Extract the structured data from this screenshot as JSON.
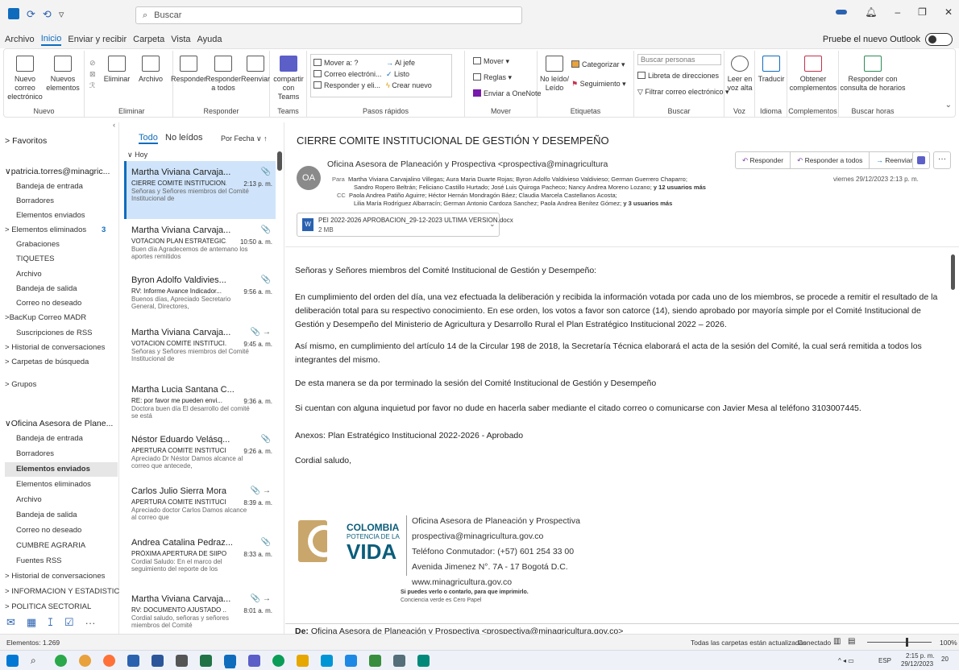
{
  "titlebar": {
    "search_placeholder": "Buscar",
    "undo": "⟲",
    "redo": "⟳",
    "customize": "▿"
  },
  "menu": [
    "Archivo",
    "Inicio",
    "Enviar y recibir",
    "Carpeta",
    "Vista",
    "Ayuda"
  ],
  "try_new": "Pruebe el nuevo Outlook",
  "ribbon": {
    "nuevo": {
      "nuevo_correo": "Nuevo correo electrónico",
      "nuevos": "Nuevos elementos",
      "label": "Nuevo"
    },
    "eliminar": {
      "eliminar": "Eliminar",
      "archivo": "Archivo",
      "label": "Eliminar"
    },
    "responder": {
      "responder": "Responder",
      "responder_todos": "Responder a todos",
      "reenviar": "Reenviar",
      "label": "Responder"
    },
    "teams": {
      "compartir": "compartir con Teams",
      "label": "Teams"
    },
    "pasos": {
      "items": [
        "Mover a: ?",
        "Correo electróni...",
        "Responder y eli...",
        "Al jefe",
        "Listo",
        "Crear nuevo"
      ],
      "label": "Pasos rápidos"
    },
    "mover": {
      "mover": "Mover",
      "reglas": "Reglas",
      "onenote": "Enviar a OneNote",
      "label": "Mover"
    },
    "etiquetas": {
      "noleido": "No leído/ Leído",
      "categorizar": "Categorizar",
      "seguimiento": "Seguimiento",
      "label": "Etiquetas"
    },
    "buscar": {
      "personas": "Buscar personas",
      "libreta": "Libreta de direcciones",
      "filtrar": "Filtrar correo electrónico",
      "label": "Buscar"
    },
    "voz": {
      "leer": "Leer en voz alta",
      "label": "Voz"
    },
    "idioma": {
      "traducir": "Traducir",
      "label": "Idioma"
    },
    "complementos": {
      "obtener": "Obtener complementos",
      "label": "Complementos"
    },
    "horas": {
      "responder": "Responder con consulta de horarios",
      "label": "Buscar horas"
    }
  },
  "nav": {
    "favoritos": "Favoritos",
    "account1": "patricia.torres@minagric...",
    "a1": [
      "Bandeja de entrada",
      "Borradores",
      "Elementos enviados",
      "Elementos eliminados",
      "Grabaciones",
      "TIQUETES",
      "Archivo",
      "Bandeja de salida",
      "Correo no deseado",
      "BacKup Correo MADR",
      "Suscripciones de RSS",
      "Historial de conversaciones",
      "Carpetas de búsqueda"
    ],
    "eliminados_count": "3",
    "grupos": "Grupos",
    "account2": "Oficina Asesora de Plane...",
    "a2": [
      "Bandeja de entrada",
      "Borradores",
      "Elementos enviados",
      "Elementos eliminados",
      "Archivo",
      "Bandeja de salida",
      "Correo no deseado",
      "CUMBRE AGRARIA",
      "Fuentes RSS",
      "Historial de conversaciones",
      "INFORMACION Y ESTADISTICA",
      "POLITICA SECTORIAL"
    ]
  },
  "list": {
    "todo": "Todo",
    "noleidos": "No leídos",
    "porfecha": "Por Fecha",
    "hoy": "Hoy",
    "messages": [
      {
        "sender": "Martha Viviana Carvaja...",
        "subject": "CIERRE COMITE INSTITUCION...",
        "preview": "Señoras y Señores miembros del Comité Institucional de",
        "time": "2:13 p. m.",
        "icon": "📎"
      },
      {
        "sender": "Martha Viviana Carvaja...",
        "subject": "VOTACION PLAN ESTRATEGIC...",
        "preview": "Buen día  Agradecemos de antemano los aportes remitidos",
        "time": "10:50 a. m.",
        "icon": "📎"
      },
      {
        "sender": "Byron Adolfo Valdivies...",
        "subject": "RV: Informe Avance Indicador...",
        "preview": "Buenos días, Apreciado Secretario General, Directores,",
        "time": "9:56 a. m.",
        "icon": "📎"
      },
      {
        "sender": "Martha Viviana Carvaja...",
        "subject": "VOTACION COMITE INSTITUCI...",
        "preview": "Señoras y Señores miembros del Comité Institucional de",
        "time": "9:45 a. m.",
        "icon": "📎 →"
      },
      {
        "sender": "Martha Lucia Santana C...",
        "subject": "RE: por favor me pueden envi...",
        "preview": "Doctora buen día El desarrollo del comité se está",
        "time": "9:36 a. m.",
        "icon": ""
      },
      {
        "sender": "Néstor Eduardo Velásq...",
        "subject": "APERTURA COMITE INSTITUCI...",
        "preview": "Apreciado Dr Néstor  Damos alcance al correo que antecede,",
        "time": "9:26 a. m.",
        "icon": "📎"
      },
      {
        "sender": "Carlos Julio Sierra Mora",
        "subject": "APERTURA COMITE INSTITUCI...",
        "preview": "Apreciado doctor Carlos Damos alcance al correo que",
        "time": "8:39 a. m.",
        "icon": "📎 →"
      },
      {
        "sender": "Andrea Catalina Pedraz...",
        "subject": "PRÓXIMA APERTURA DE SIIPO;...",
        "preview": "Cordial Saludo:  En el marco del seguimiento del reporte de los",
        "time": "8:33 a. m.",
        "icon": "📎"
      },
      {
        "sender": "Martha Viviana Carvaja...",
        "subject": "RV: DOCUMENTO AJUSTADO ...",
        "preview": "Cordial saludo, señoras y señores miembros del Comité",
        "time": "8:01 a. m.",
        "icon": "📎 →"
      }
    ]
  },
  "reader": {
    "subject": "CIERRE COMITE INSTITUCIONAL DE GESTIÓN Y DESEMPEÑO",
    "avatar": "OA",
    "from": "Oficina Asesora de Planeación y Prospectiva <prospectiva@minagricultura",
    "para_label": "Para",
    "para": "Martha Viviana Carvajalino Villegas; Aura Maria Duarte Rojas; Byron Adolfo Valdivieso Valdivieso; German Guerrero Chaparro;",
    "para2": "Sandro Ropero Beltrán; Feliciano Castillo Hurtado; José Luis Quiroga Pacheco; Nancy Andrea Moreno Lozano;",
    "para_more": "y 12 usuarios más",
    "cc_label": "CC",
    "cc": "Paola Andrea Patiño Aguirre; Héctor Hernán Mondragón Báez; Claudia Marcela Castellanos Acosta;",
    "cc2": "Lilia María Rodríguez Albarracín; German Antonio Cardoza Sanchez; Paola Andrea Benítez Gómez;",
    "cc_more": "y 3 usuarios más",
    "date": "viernes 29/12/2023 2:13 p. m.",
    "btn_responder": "Responder",
    "btn_todos": "Responder a todos",
    "btn_reenviar": "Reenviar",
    "attach_name": "PEI 2022-2026 APROBACION_29-12-2023 ULTIMA VERSION.docx",
    "attach_size": "2 MB",
    "p1": "Señoras y Señores miembros del Comité Institucional de Gestión y Desempeño:",
    "p2": "En cumplimiento del orden del día, una vez efectuada la deliberación y recibida la información votada por cada uno de los miembros, se procede a remitir el resultado de la deliberación total para su respectivo conocimiento. En ese orden, los votos a favor son catorce (14), siendo aprobado por mayoría simple por el Comité Institucional de Gestión y Desempeño  del Ministerio de Agricultura y Desarrollo Rural el Plan Estratégico Institucional 2022 – 2026.",
    "p3": "Así mismo, en cumplimiento del artículo 14 de la Circular 198 de 2018, la Secretaría Técnica elaborará el acta de la sesión del Comité, la cual será remitida a todos los integrantes del mismo.",
    "p4": "De esta manera se da por terminado la sesión del Comité Institucional de Gestión y Desempeño",
    "p5": "Si cuentan con alguna inquietud por favor no dude en hacerla saber mediante el citado correo o comunicarse con Javier Mesa al teléfono 3103007445.",
    "p6": "Anexos:  Plan Estratégico Institucional 2022-2026 - Aprobado",
    "p7": "Cordial saludo,",
    "sig": [
      "Oficina Asesora de Planeación y Prospectiva",
      "prospectiva@minagricultura.gov.co",
      "Teléfono Conmutador: (+57) 601 254 33 00",
      "Avenida Jimenez N°. 7A - 17 Bogotá D.C.",
      "www.minagricultura.gov.co"
    ],
    "logo1": "COLOMBIA",
    "logo2": "POTENCIA DE LA",
    "logo3": "VIDA",
    "paper1": "Si puedes verlo o contarlo, para que imprimirlo.",
    "paper2": "Conciencia verde es Cero Papel",
    "de_label": "De:",
    "de": "Oficina Asesora de Planeación y Prospectiva <prospectiva@minagricultura.gov.co>"
  },
  "status": {
    "elementos": "Elementos: 1.269",
    "sync": "Todas las carpetas están actualizadas.",
    "conectado": "Conectado",
    "zoom": "100%"
  },
  "taskbar": {
    "lang": "ESP",
    "time": "2:15 p. m.",
    "date": "29/12/2023",
    "notif": "20"
  }
}
